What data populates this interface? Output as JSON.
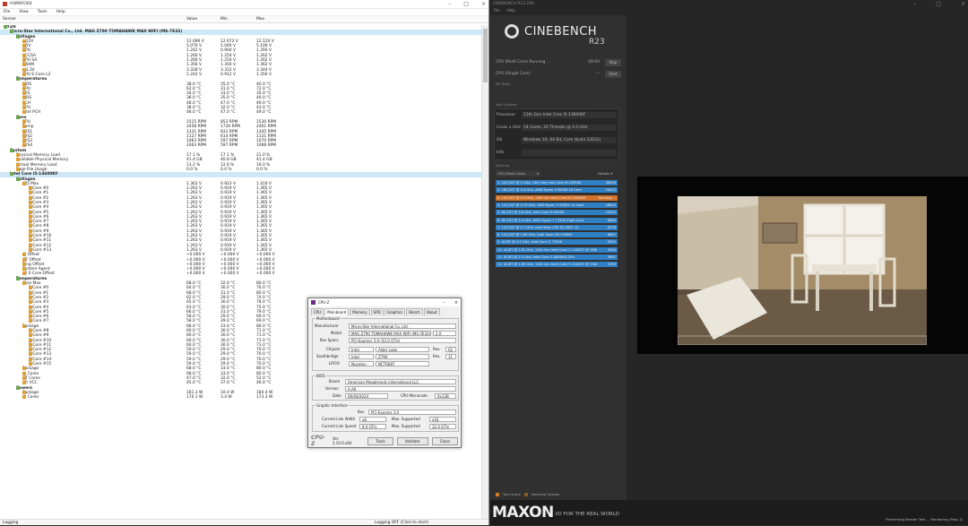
{
  "hwinfo": {
    "title": "HWiNFO64",
    "menu": [
      "File",
      "View",
      "Tools",
      "Help"
    ],
    "columns": {
      "sensor": "Sensor",
      "value": "Value",
      "min": "Min",
      "max": "Max"
    },
    "rows": [
      {
        "label": "NYZH",
        "indent": 0,
        "type": "group"
      },
      {
        "label": "Micro-Star International Co., Ltd. MAG Z790 TOMAHAWK MAX WIFI (MS-7E32)",
        "indent": 1,
        "type": "device",
        "hl": true
      },
      {
        "label": "Voltages",
        "indent": 2,
        "type": "group"
      },
      {
        "label": "+12V",
        "indent": 3,
        "v": "12.096 V",
        "mn": "12.072 V",
        "mx": "12.120 V"
      },
      {
        "label": "+5V",
        "indent": 3,
        "v": "5.070 V",
        "mn": "5.040 V",
        "mx": "5.100 V"
      },
      {
        "label": "CPU",
        "indent": 3,
        "v": "1.242 V",
        "mn": "0.904 V",
        "mx": "1.356 V"
      },
      {
        "label": "VCCSA",
        "indent": 3,
        "v": "1.260 V",
        "mn": "1.254 V",
        "mx": "1.262 V"
      },
      {
        "label": "CPU SA",
        "indent": 3,
        "v": "1.260 V",
        "mn": "1.254 V",
        "mx": "1.262 V"
      },
      {
        "label": "DRAM",
        "indent": 3,
        "v": "1.356 V",
        "mn": "1.350 V",
        "mx": "1.362 V"
      },
      {
        "label": "+3.3V",
        "indent": 3,
        "v": "3.328 V",
        "mn": "3.312 V",
        "mx": "3.344 V"
      },
      {
        "label": "CPU E-Core L2",
        "indent": 3,
        "v": "1.242 V",
        "mn": "0.912 V",
        "mx": "1.356 V"
      },
      {
        "label": "Temperatures",
        "indent": 2,
        "type": "group"
      },
      {
        "label": "MOS",
        "indent": 3,
        "v": "38.0 °C",
        "mn": "35.0 °C",
        "mx": "40.0 °C"
      },
      {
        "label": "CPU",
        "indent": 3,
        "v": "62.0 °C",
        "mn": "31.0 °C",
        "mx": "72.0 °C"
      },
      {
        "label": "SYS",
        "indent": 3,
        "v": "34.0 °C",
        "mn": "33.0 °C",
        "mx": "35.0 °C"
      },
      {
        "label": "MOS",
        "indent": 3,
        "v": "38.0 °C",
        "mn": "35.0 °C",
        "mx": "40.0 °C"
      },
      {
        "label": "PCH",
        "indent": 3,
        "v": "48.0 °C",
        "mn": "47.0 °C",
        "mx": "49.0 °C"
      },
      {
        "label": "CPU",
        "indent": 3,
        "v": "38.0 °C",
        "mn": "32.0 °C",
        "mx": "43.0 °C"
      },
      {
        "label": "Intel PCH",
        "indent": 3,
        "v": "48.0 °C",
        "mn": "47.0 °C",
        "mx": "49.0 °C"
      },
      {
        "label": "Fans",
        "indent": 2,
        "type": "group"
      },
      {
        "label": "CPU",
        "indent": 3,
        "v": "1515 RPM",
        "mn": "853 RPM",
        "mx": "1530 RPM"
      },
      {
        "label": "Pump",
        "indent": 3,
        "v": "2458 RPM",
        "mn": "1720 RPM",
        "mx": "2461 RPM"
      },
      {
        "label": "SYS1",
        "indent": 3,
        "v": "1331 RPM",
        "mn": "831 RPM",
        "mx": "1345 RPM"
      },
      {
        "label": "SYS2",
        "indent": 3,
        "v": "1127 RPM",
        "mn": "614 RPM",
        "mx": "1131 RPM"
      },
      {
        "label": "SYS3",
        "indent": 3,
        "v": "1063 RPM",
        "mn": "597 RPM",
        "mx": "1070 RPM"
      },
      {
        "label": "SYS4",
        "indent": 3,
        "v": "1063 RPM",
        "mn": "597 RPM",
        "mx": "1068 RPM"
      },
      {
        "label": "System",
        "indent": 1,
        "type": "device"
      },
      {
        "label": "Physical Memory Load",
        "indent": 2,
        "v": "17.1 %",
        "mn": "17.1 %",
        "mx": "21.0 %"
      },
      {
        "label": "Available Physical Memory",
        "indent": 2,
        "v": "41.4 GB",
        "mn": "40.8 GB",
        "mx": "41.4 GB"
      },
      {
        "label": "Virtual Memory Load",
        "indent": 2,
        "v": "13.2 %",
        "mn": "12.6 %",
        "mx": "16.0 %"
      },
      {
        "label": "Page File Usage",
        "indent": 2,
        "v": "0.0 %",
        "mn": "0.0 %",
        "mx": "0.0 %"
      },
      {
        "label": "Intel Core i5-13600KF",
        "indent": 1,
        "type": "device",
        "hl": true
      },
      {
        "label": "Voltages",
        "indent": 2,
        "type": "group"
      },
      {
        "label": "VID Max",
        "indent": 3,
        "v": "1.363 V",
        "mn": "0.923 V",
        "mx": "1.419 V"
      },
      {
        "label": "P-Core #0",
        "indent": 4,
        "v": "1.263 V",
        "mn": "0.919 V",
        "mx": "1.365 V"
      },
      {
        "label": "P-Core #1",
        "indent": 4,
        "v": "1.263 V",
        "mn": "0.919 V",
        "mx": "1.365 V"
      },
      {
        "label": "P-Core #2",
        "indent": 4,
        "v": "1.263 V",
        "mn": "0.919 V",
        "mx": "1.365 V"
      },
      {
        "label": "P-Core #3",
        "indent": 4,
        "v": "1.263 V",
        "mn": "0.919 V",
        "mx": "1.365 V"
      },
      {
        "label": "P-Core #4",
        "indent": 4,
        "v": "1.263 V",
        "mn": "0.919 V",
        "mx": "1.365 V"
      },
      {
        "label": "P-Core #5",
        "indent": 4,
        "v": "1.263 V",
        "mn": "0.919 V",
        "mx": "1.365 V"
      },
      {
        "label": "E-Core #6",
        "indent": 4,
        "v": "1.263 V",
        "mn": "0.919 V",
        "mx": "1.365 V"
      },
      {
        "label": "E-Core #7",
        "indent": 4,
        "v": "1.263 V",
        "mn": "0.919 V",
        "mx": "1.365 V"
      },
      {
        "label": "E-Core #8",
        "indent": 4,
        "v": "1.263 V",
        "mn": "0.919 V",
        "mx": "1.365 V"
      },
      {
        "label": "E-Core #9",
        "indent": 4,
        "v": "1.263 V",
        "mn": "0.919 V",
        "mx": "1.365 V"
      },
      {
        "label": "E-Core #10",
        "indent": 4,
        "v": "1.263 V",
        "mn": "0.919 V",
        "mx": "1.365 V"
      },
      {
        "label": "E-Core #11",
        "indent": 4,
        "v": "1.263 V",
        "mn": "0.919 V",
        "mx": "1.365 V"
      },
      {
        "label": "E-Core #12",
        "indent": 4,
        "v": "1.263 V",
        "mn": "0.919 V",
        "mx": "1.365 V"
      },
      {
        "label": "E-Core #13",
        "indent": 4,
        "v": "1.263 V",
        "mn": "0.919 V",
        "mx": "1.365 V"
      },
      {
        "label": "IA Offset",
        "indent": 3,
        "v": "+0.000 V",
        "mn": "+0.000 V",
        "mx": "+0.000 V"
      },
      {
        "label": "GT Offset",
        "indent": 3,
        "v": "+0.000 V",
        "mn": "+0.000 V",
        "mx": "+0.000 V"
      },
      {
        "label": "Ring Offset",
        "indent": 3,
        "v": "+0.000 V",
        "mn": "+0.000 V",
        "mx": "+0.000 V"
      },
      {
        "label": "System Agent",
        "indent": 3,
        "v": "+0.000 V",
        "mn": "+0.000 V",
        "mx": "+0.000 V"
      },
      {
        "label": "L2 E-Core Offset",
        "indent": 3,
        "v": "+0.000 V",
        "mn": "+0.000 V",
        "mx": "+0.000 V"
      },
      {
        "label": "Temperatures",
        "indent": 2,
        "type": "group"
      },
      {
        "label": "Core Max",
        "indent": 3,
        "v": "68.0 °C",
        "mn": "32.0 °C",
        "mx": "80.0 °C"
      },
      {
        "label": "P-Core #0",
        "indent": 4,
        "v": "64.0 °C",
        "mn": "30.0 °C",
        "mx": "76.0 °C"
      },
      {
        "label": "P-Core #1",
        "indent": 4,
        "v": "68.0 °C",
        "mn": "31.0 °C",
        "mx": "80.0 °C"
      },
      {
        "label": "P-Core #2",
        "indent": 4,
        "v": "62.0 °C",
        "mn": "29.0 °C",
        "mx": "74.0 °C"
      },
      {
        "label": "P-Core #3",
        "indent": 4,
        "v": "65.0 °C",
        "mn": "30.0 °C",
        "mx": "78.0 °C"
      },
      {
        "label": "P-Core #4",
        "indent": 4,
        "v": "63.0 °C",
        "mn": "30.0 °C",
        "mx": "75.0 °C"
      },
      {
        "label": "P-Core #5",
        "indent": 4,
        "v": "66.0 °C",
        "mn": "31.0 °C",
        "mx": "79.0 °C"
      },
      {
        "label": "E-Core #6",
        "indent": 4,
        "v": "58.0 °C",
        "mn": "29.0 °C",
        "mx": "69.0 °C"
      },
      {
        "label": "E-Core #7",
        "indent": 4,
        "v": "58.0 °C",
        "mn": "29.0 °C",
        "mx": "69.0 °C"
      },
      {
        "label": "Package",
        "indent": 3,
        "v": "68.0 °C",
        "mn": "33.0 °C",
        "mx": "80.0 °C"
      },
      {
        "label": "E-Core #8",
        "indent": 4,
        "v": "60.0 °C",
        "mn": "30.0 °C",
        "mx": "71.0 °C"
      },
      {
        "label": "E-Core #9",
        "indent": 4,
        "v": "60.0 °C",
        "mn": "30.0 °C",
        "mx": "71.0 °C"
      },
      {
        "label": "E-Core #10",
        "indent": 4,
        "v": "60.0 °C",
        "mn": "30.0 °C",
        "mx": "71.0 °C"
      },
      {
        "label": "E-Core #11",
        "indent": 4,
        "v": "60.0 °C",
        "mn": "30.0 °C",
        "mx": "71.0 °C"
      },
      {
        "label": "E-Core #12",
        "indent": 4,
        "v": "59.0 °C",
        "mn": "29.0 °C",
        "mx": "70.0 °C"
      },
      {
        "label": "E-Core #13",
        "indent": 4,
        "v": "59.0 °C",
        "mn": "29.0 °C",
        "mx": "70.0 °C"
      },
      {
        "label": "E-Core #14",
        "indent": 4,
        "v": "59.0 °C",
        "mn": "29.0 °C",
        "mx": "70.0 °C"
      },
      {
        "label": "E-Core #15",
        "indent": 4,
        "v": "59.0 °C",
        "mn": "29.0 °C",
        "mx": "70.0 °C"
      },
      {
        "label": "Package",
        "indent": 3,
        "v": "68.0 °C",
        "mn": "33.0 °C",
        "mx": "80.0 °C"
      },
      {
        "label": "IA Cores",
        "indent": 3,
        "v": "68.0 °C",
        "mn": "33.0 °C",
        "mx": "80.0 °C"
      },
      {
        "label": "GT Cores",
        "indent": 3,
        "v": "47.0 °C",
        "mn": "32.0 °C",
        "mx": "52.0 °C"
      },
      {
        "label": "VR VCC",
        "indent": 3,
        "v": "45.0 °C",
        "mn": "37.0 °C",
        "mx": "46.0 °C"
      },
      {
        "label": "Powers",
        "indent": 2,
        "type": "group"
      },
      {
        "label": "Package",
        "indent": 3,
        "v": "181.3 W",
        "mn": "10.4 W",
        "mx": "184.4 W"
      },
      {
        "label": "IA Cores",
        "indent": 3,
        "v": "170.1 W",
        "mn": "3.4 W",
        "mx": "173.3 W"
      }
    ],
    "status": {
      "left": "Logging",
      "right": "Logging OFF (Click to start)"
    }
  },
  "cpuz": {
    "title": "CPU-Z",
    "tabs": [
      "CPU",
      "Mainboard",
      "Memory",
      "SPD",
      "Graphics",
      "Bench",
      "About"
    ],
    "active_tab": "Mainboard",
    "motherboard": {
      "group": "Motherboard",
      "manufacturer_label": "Manufacturer",
      "manufacturer": "Micro-Star International Co. Ltd.",
      "model_label": "Model",
      "model": "MAG Z790 TOMAHAWK MAX WIFI (MS-7E32)",
      "model_rev": "2.0",
      "bus_label": "Bus Specs.",
      "bus": "PCI-Express 5.0 (32.0 GT/s)",
      "chipset_label": "Chipset",
      "chipset_vendor": "Intel",
      "chipset_name": "Alder Lake",
      "chipset_rev_label": "Rev.",
      "chipset_rev": "02",
      "south_label": "Southbridge",
      "south_vendor": "Intel",
      "south_name": "Z790",
      "south_rev_label": "Rev.",
      "south_rev": "11",
      "lpcio_label": "LPCIO",
      "lpcio_vendor": "Nuvoton",
      "lpcio_name": "NCT6687"
    },
    "bios": {
      "group": "BIOS",
      "brand_label": "Brand",
      "brand": "American Megatrends International LLC.",
      "version_label": "Version",
      "version": "A.A0",
      "date_label": "Date",
      "date": "06/04/2024",
      "microcode_label": "CPU Microcode",
      "microcode": "0x12B"
    },
    "gfx": {
      "group": "Graphic Interface",
      "bus_label": "Bus",
      "bus": "PCI-Express 3.0",
      "width_label": "Current Link Width",
      "width": "x8",
      "width_max_label": "Max. Supported",
      "width_max": "x16",
      "speed_label": "Current Link Speed",
      "speed": "8.0 GT/s",
      "speed_max_label": "Max. Supported",
      "speed_max": "32.0 GT/s"
    },
    "footer": {
      "logo": "CPU-Z",
      "version": "Ver. 2.10.0.x64",
      "tools": "Tools",
      "validate": "Validate",
      "close": "Close"
    }
  },
  "cinebench": {
    "window_title": "CINEBENCH R23.200",
    "menu": [
      "File",
      "Help"
    ],
    "brand": "CINEBENCH",
    "version": "R23",
    "tests": [
      {
        "label": "CPU (Multi Core)  Running ...",
        "score": "00:00",
        "button": "Stop"
      },
      {
        "label": "CPU (Single Core)",
        "score": "---",
        "button": "Start"
      }
    ],
    "min_duration": "MP Ratio",
    "system_title": "Your System",
    "system": [
      {
        "k": "Processor",
        "v": "13th Gen Intel Core i5-13600KF"
      },
      {
        "k": "Cores x GHz",
        "v": "14 Cores, 20 Threads @ 3.5 GHz"
      },
      {
        "k": "OS",
        "v": "Windows 10, 64 Bit, Core (build 22631)"
      },
      {
        "k": "Info",
        "v": ""
      }
    ],
    "ranking_title": "Ranking",
    "ranking_filter": "CPU (Multi Core)",
    "ranking_details": "Details",
    "ranking": [
      {
        "t": "1. 24C/32T @ 3 GHz, 13th Gen Intel Core i9-13900K",
        "s": "38549",
        "c": "#2f7fc4"
      },
      {
        "t": "2. 16C/32T @ 3.4 GHz, AMD Ryzen 9 5950X 16-Core",
        "s": "24413",
        "c": "#2f7fc4"
      },
      {
        "t": "3. 14C/20T @ 3.5 GHz, 13th Gen Intel Core i5-13600KF",
        "s": "Running ...",
        "c": "#d4742a"
      },
      {
        "t": "4. 12C/24T @ 3.79 GHz, AMD Ryzen 9 5900X 12-Core",
        "s": "18815",
        "c": "#2f7fc4"
      },
      {
        "t": "5. 8C/16T @ 3.6 GHz, Intel Core i9-9900K",
        "s": "12042",
        "c": "#2f7fc4"
      },
      {
        "t": "6. 8C/16T @ 3.4 GHz, AMD Ryzen 7 1700X Eight-Core",
        "s": "8889",
        "c": "#2f7fc4"
      },
      {
        "t": "7. 12C/24T @ 2.7 GHz, Intel Xeon CPU E5-2697 v2",
        "s": "8378",
        "c": "#2f7fc4"
      },
      {
        "t": "8. 12C/24T @ 2.66 GHz, Intel Xeon CPU X5650",
        "s": "6867",
        "c": "#2f7fc4"
      },
      {
        "t": "9. 4C/8T @ 4.2 GHz, Intel Core i7-7700K",
        "s": "6302",
        "c": "#2f7fc4"
      },
      {
        "t": "10. 4C/8T @ 2.81 GHz, 11th Gen Intel Core i7-1165G7 @ 28W",
        "s": "4904",
        "c": "#2f7fc4"
      },
      {
        "t": "11. 4C/8T @ 2.3 GHz, Intel Core i7-4850HQ CPU",
        "s": "3891",
        "c": "#2f7fc4"
      },
      {
        "t": "12. 4C/8T @ 1.69 GHz, 11th Gen Intel Core i7-1165G7 @ 15W",
        "s": "3769",
        "c": "#2f7fc4"
      }
    ],
    "legend": {
      "your_score": "Your Score",
      "identical": "Identical System"
    },
    "footer": {
      "logo": "MAXON",
      "tagline": "3D FOR THE REAL WORLD",
      "status": "Performing Render Test ... Rendering (Pass 1)"
    }
  }
}
